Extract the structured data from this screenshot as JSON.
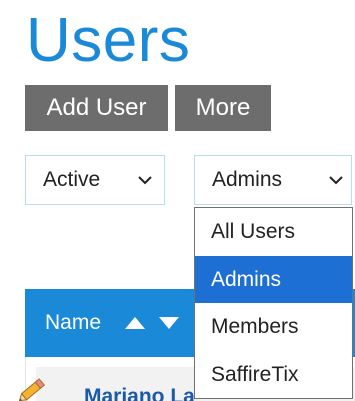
{
  "page": {
    "title": "Users"
  },
  "toolbar": {
    "add_user_label": "Add User",
    "more_label": "More"
  },
  "filters": {
    "status_selected": "Active",
    "role_selected": "Admins",
    "role_options": [
      "All Users",
      "Admins",
      "Members",
      "SaffireTix"
    ],
    "role_highlighted_index": 1
  },
  "table": {
    "columns": [
      {
        "label": "Name",
        "sortable": true
      }
    ],
    "rows": [
      {
        "name": "Mariano La",
        "edit_icon": "pencil-icon"
      }
    ]
  },
  "colors": {
    "accent": "#1a8ad8",
    "button_bg": "#6d6d6d",
    "option_highlight": "#1e6fd4",
    "link": "#1a5aa8"
  },
  "icons": {
    "select_arrow": "chevron-down-icon",
    "sort_up": "sort-ascending-icon",
    "sort_down": "sort-descending-icon",
    "edit": "pencil-icon"
  }
}
